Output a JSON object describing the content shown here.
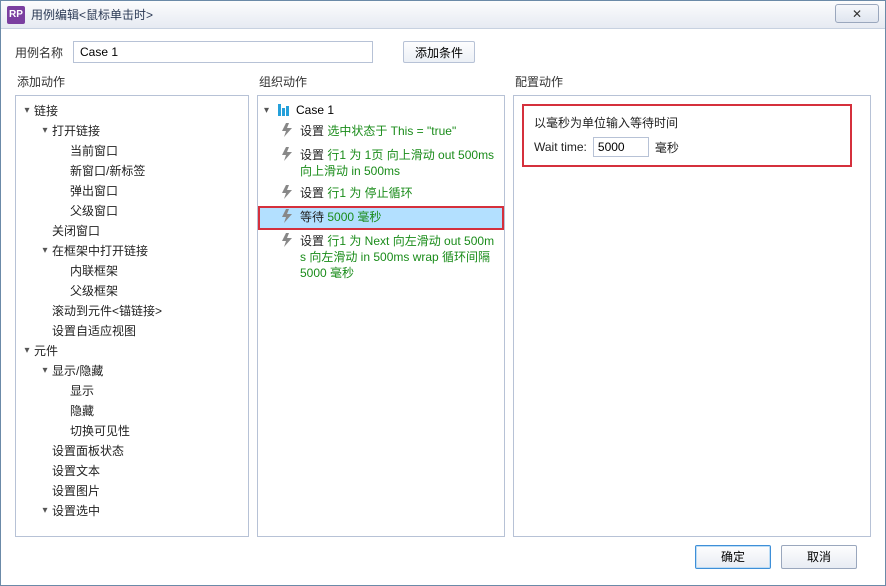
{
  "window": {
    "title": "用例编辑<鼠标单击时>"
  },
  "form": {
    "name_label": "用例名称",
    "name_value": "Case 1",
    "add_condition": "添加条件"
  },
  "panels": {
    "left_header": "添加动作",
    "middle_header": "组织动作",
    "right_header": "配置动作"
  },
  "left_tree": {
    "g0": "链接",
    "g0_0": "打开链接",
    "g0_0_0": "当前窗口",
    "g0_0_1": "新窗口/新标签",
    "g0_0_2": "弹出窗口",
    "g0_0_3": "父级窗口",
    "g0_1": "关闭窗口",
    "g0_2": "在框架中打开链接",
    "g0_2_0": "内联框架",
    "g0_2_1": "父级框架",
    "g0_3": "滚动到元件<锚链接>",
    "g0_4": "设置自适应视图",
    "g1": "元件",
    "g1_0": "显示/隐藏",
    "g1_0_0": "显示",
    "g1_0_1": "隐藏",
    "g1_0_2": "切换可见性",
    "g1_1": "设置面板状态",
    "g1_2": "设置文本",
    "g1_3": "设置图片",
    "g1_4": "设置选中"
  },
  "case": {
    "label": "Case 1",
    "a1_prefix": "设置 ",
    "a1_green": "选中状态于 This = \"true\"",
    "a2_prefix": "设置 ",
    "a2_green": "行1 为 1页 向上滑动 out 500ms 向上滑动 in 500ms",
    "a3_prefix": "设置 ",
    "a3_green": "行1 为 停止循环",
    "a4_prefix": "等待 ",
    "a4_green": "5000 毫秒",
    "a5_prefix": "设置 ",
    "a5_green": "行1 为 Next 向左滑动 out 500ms 向左滑动 in 500ms wrap 循环间隔 5000 毫秒"
  },
  "config": {
    "line1": "以毫秒为单位输入等待时间",
    "wait_label": "Wait time:",
    "wait_value": "5000",
    "wait_unit": "毫秒"
  },
  "footer": {
    "ok": "确定",
    "cancel": "取消"
  }
}
